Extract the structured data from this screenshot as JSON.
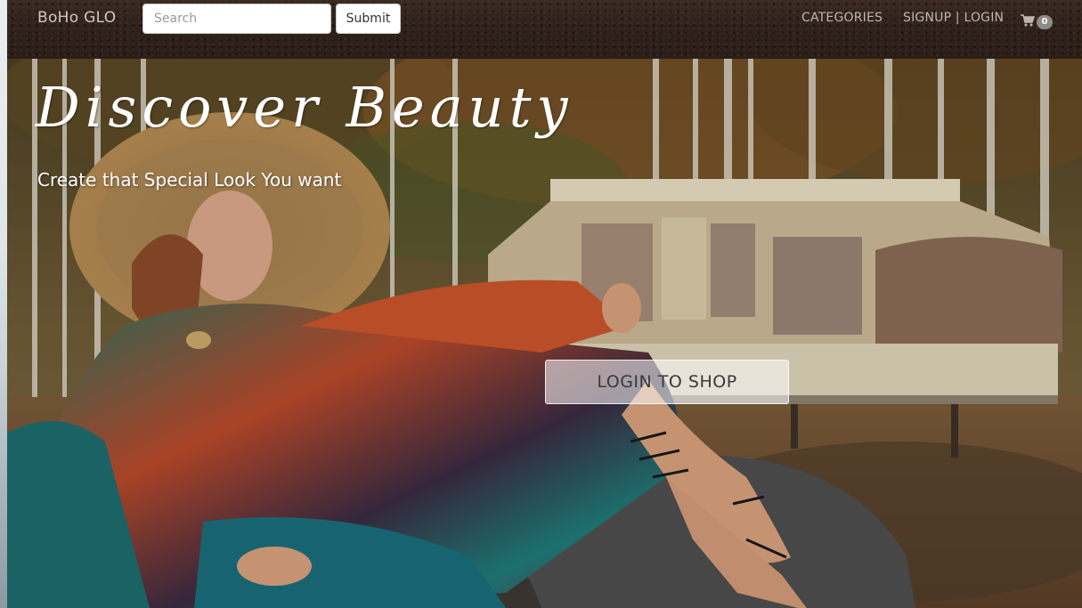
{
  "navbar": {
    "brand": "BoHo GLO",
    "search": {
      "placeholder": "Search",
      "value": ""
    },
    "submit_label": "Submit",
    "links": {
      "categories": "CATEGORIES",
      "signup_login": "SIGNUP | LOGIN"
    },
    "cart": {
      "icon": "shopping-cart-icon",
      "count": "0"
    }
  },
  "hero": {
    "title": "Discover Beauty",
    "subtitle": "Create that Special Look You want",
    "cta_label": "LOGIN TO SHOP"
  },
  "colors": {
    "navbar_bg": "#2e211b",
    "nav_text": "#bdb5ae",
    "hero_text": "#ffffff",
    "cta_bg": "rgba(255,255,255,0.55)"
  }
}
